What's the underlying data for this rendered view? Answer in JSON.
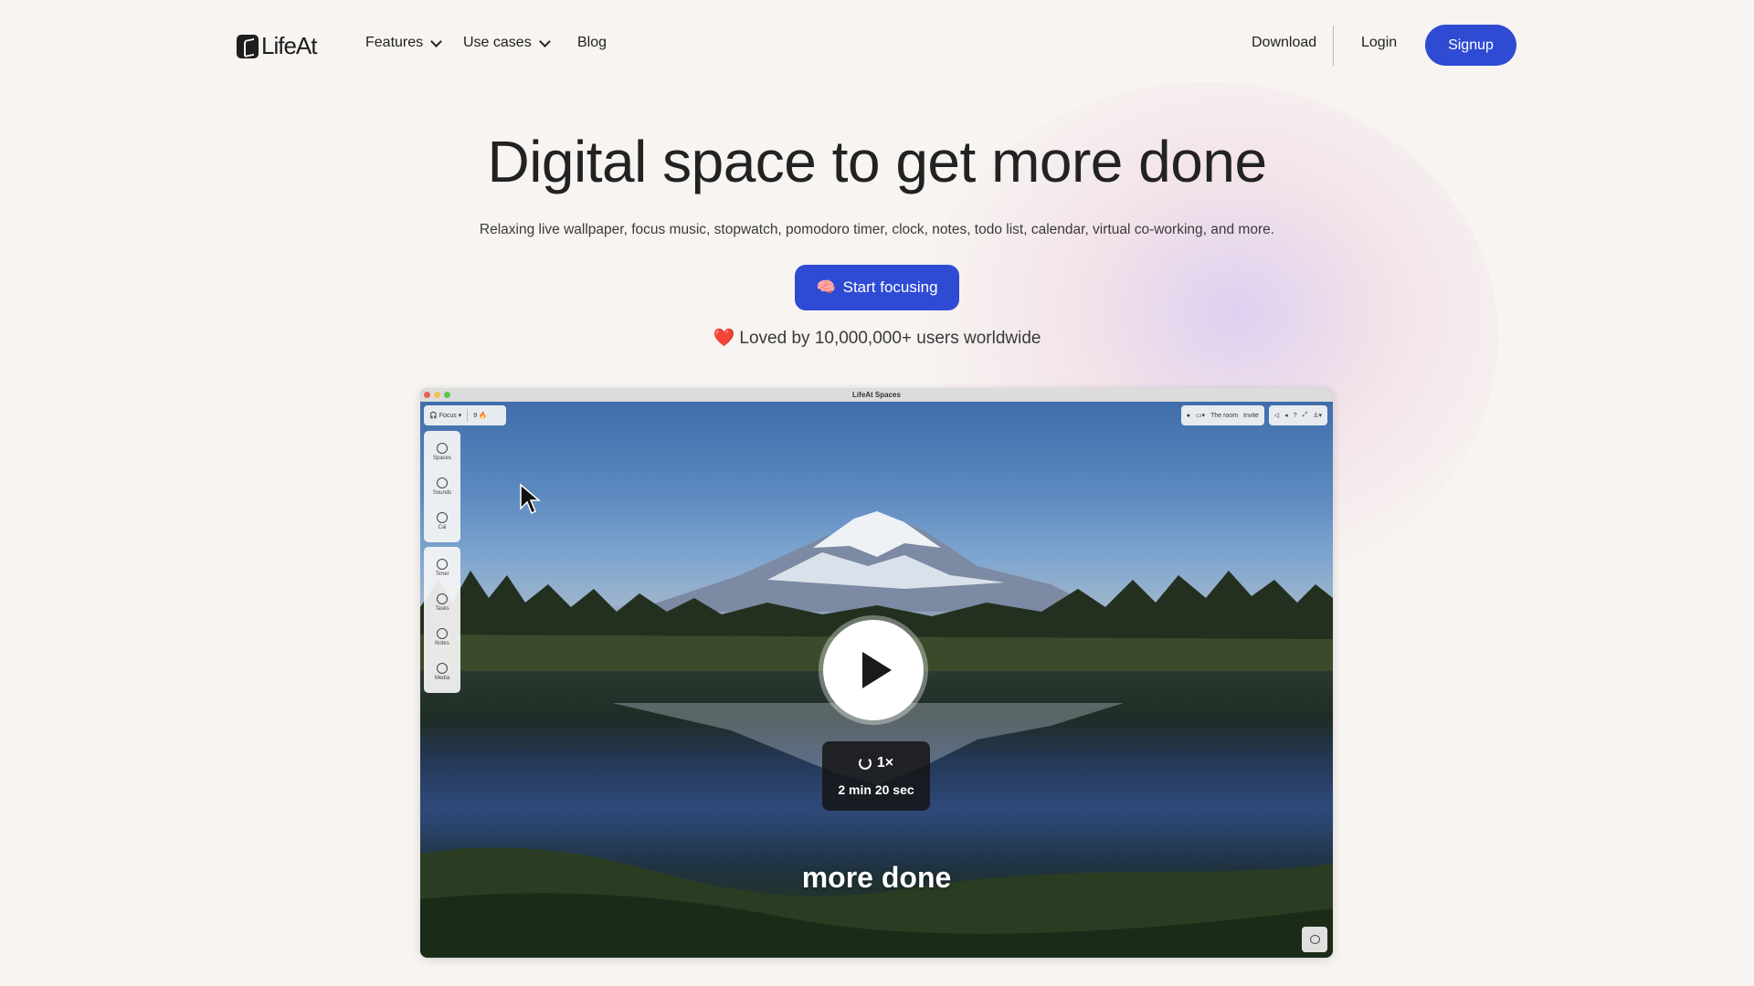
{
  "nav": {
    "logo_text": "LifeAt",
    "features": "Features",
    "use_cases": "Use cases",
    "blog": "Blog",
    "download": "Download",
    "login": "Login",
    "signup": "Signup"
  },
  "hero": {
    "title": "Digital space to get more done",
    "subtitle": "Relaxing live wallpaper, focus music, stopwatch, pomodoro timer, clock, notes, todo list, calendar, virtual co-working, and more.",
    "cta": "Start focusing",
    "cta_icon": "🧠",
    "loved_icon": "❤️",
    "loved": "Loved by 10,000,000+ users worldwide"
  },
  "video": {
    "window_title": "LifeAt Spaces",
    "toolbar_left": {
      "focus": "Focus",
      "streak": "9 🔥"
    },
    "toolbar_right": {
      "room": "The room",
      "invite": "Invite"
    },
    "sidebar": [
      "Spaces",
      "Sounds",
      "Cal",
      "Timer",
      "Tasks",
      "Notes",
      "Media"
    ],
    "speed": "1×",
    "duration": "2 min 20 sec",
    "caption": "more done"
  },
  "colors": {
    "accent": "#2f4bd4",
    "background": "#f7f4f1",
    "text": "#222222"
  }
}
